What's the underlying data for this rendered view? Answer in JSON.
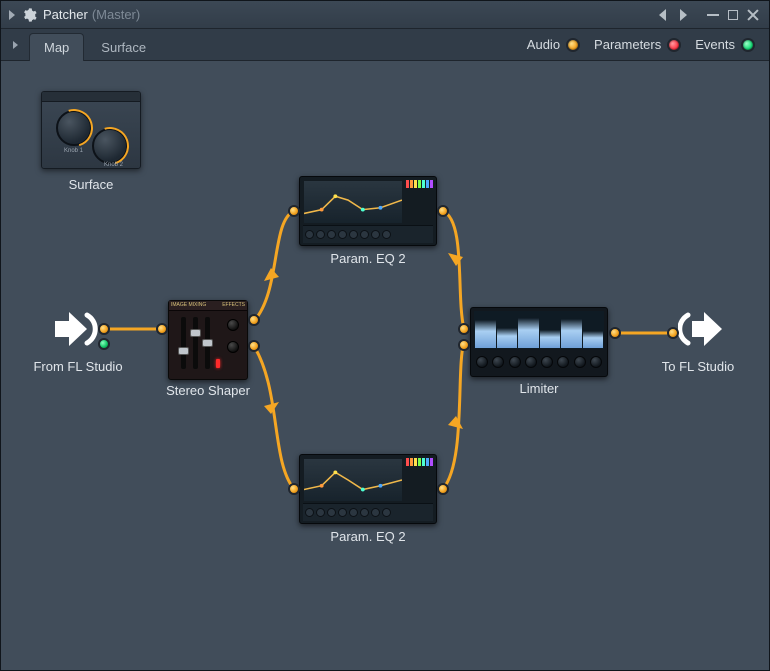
{
  "title": {
    "plugin": "Patcher",
    "channel": "(Master)"
  },
  "tabs": {
    "map": "Map",
    "surface": "Surface"
  },
  "indicators": {
    "audio": "Audio",
    "parameters": "Parameters",
    "events": "Events"
  },
  "nodes": {
    "surface": "Surface",
    "from": "From FL Studio",
    "to": "To FL Studio",
    "shaper": "Stereo Shaper",
    "eq_top": "Param. EQ 2",
    "eq_bot": "Param. EQ 2",
    "limiter": "Limiter",
    "shaper_header_left": "IMAGE MIXING",
    "shaper_header_right": "EFFECTS",
    "surface_knob1": "Knob 1",
    "surface_knob2": "Knob 2"
  },
  "eq_band_colors": [
    "#ff4d4d",
    "#ff9a3c",
    "#ffe14d",
    "#7bff4d",
    "#4dffd1",
    "#4daaff",
    "#b14dff"
  ]
}
